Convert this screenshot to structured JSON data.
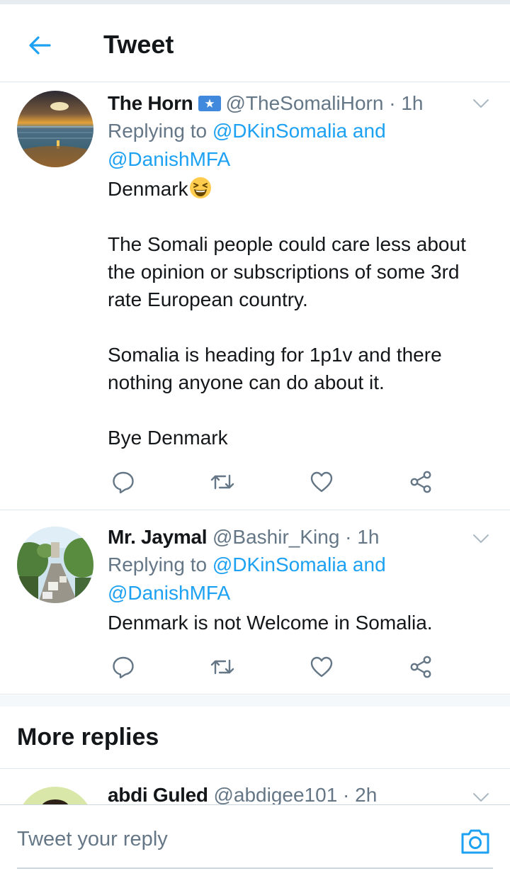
{
  "header": {
    "title": "Tweet"
  },
  "tweets": [
    {
      "name": "The Horn",
      "handle": "@TheSomaliHorn",
      "time": "· 1h",
      "reply_prefix": "Replying to ",
      "reply_targets": "@DKinSomalia and @DanishMFA",
      "body": [
        "Denmark",
        "",
        "The Somali people could care less about the opinion or subscriptions of some 3rd rate European country.",
        "",
        "Somalia is heading for 1p1v and there nothing anyone can do about it.",
        "",
        "Bye Denmark"
      ]
    },
    {
      "name": "Mr. Jaymal",
      "handle": "@Bashir_King",
      "time": "· 1h",
      "reply_prefix": "Replying to ",
      "reply_targets": "@DKinSomalia and @DanishMFA",
      "body": [
        "Denmark is not Welcome in Somalia."
      ]
    },
    {
      "name": "abdi Guled",
      "handle": "@abdigee101",
      "time": "· 2h"
    }
  ],
  "more_replies": {
    "title": "More replies"
  },
  "reply_bar": {
    "placeholder": "Tweet your reply"
  },
  "colors": {
    "accent": "#1da1f2",
    "secondary_text": "#657786",
    "divider": "#e1e8ed"
  },
  "icons": [
    "back-arrow-icon",
    "somalia-flag-icon",
    "grinning-squint-emoji-icon",
    "chevron-down-icon",
    "reply-icon",
    "retweet-icon",
    "like-icon",
    "share-icon",
    "camera-icon"
  ]
}
